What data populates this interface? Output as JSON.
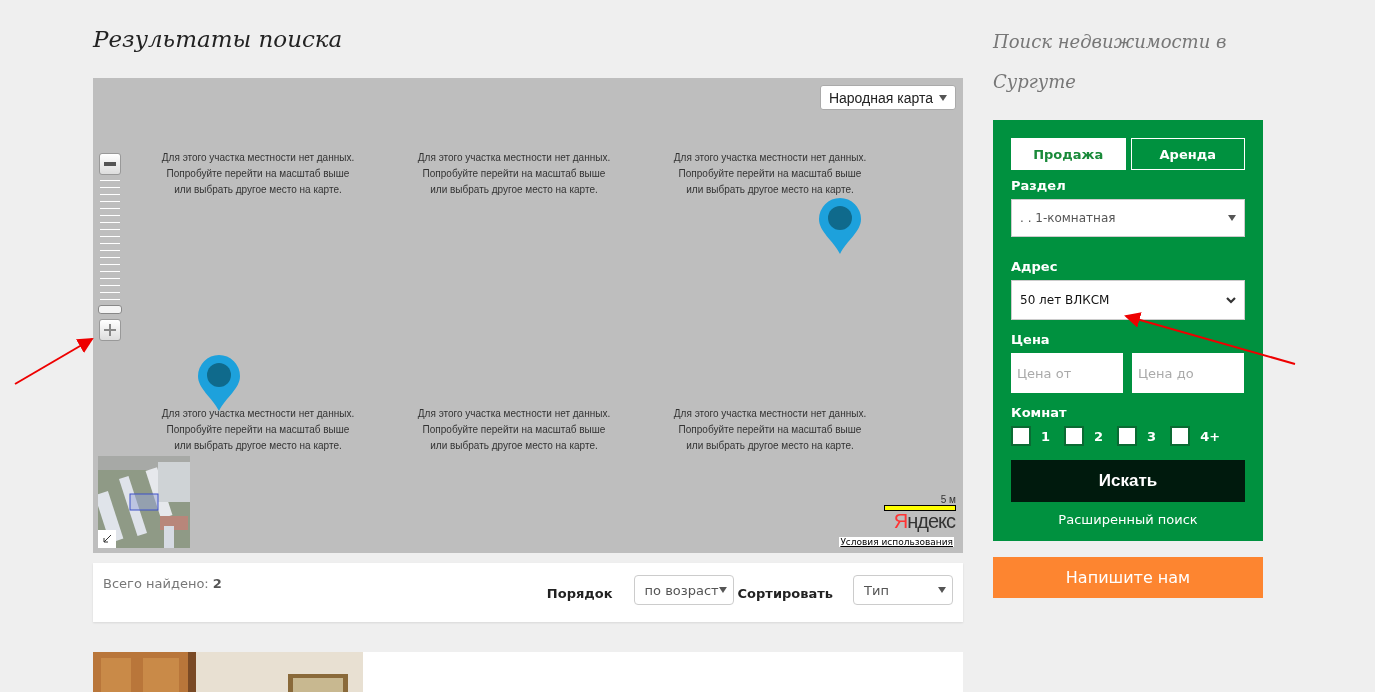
{
  "page_title": "Результаты поиска",
  "map": {
    "type_selector": "Народная карта",
    "tiles": [
      {
        "lines": [
          "Для этого участка местности нет данных.",
          "Попробуйте перейти на масштаб выше",
          "или выбрать другое место на карте."
        ]
      },
      {
        "lines": [
          "Для этого участка местности нет данных.",
          "Попробуйте перейти на масштаб выше",
          "или выбрать другое место на карте."
        ]
      },
      {
        "lines": [
          "Для этого участка местности нет данных.",
          "Попробуйте перейти на масштаб выше",
          "или выбрать другое место на карте."
        ]
      },
      {
        "lines": [
          "Для этого участка местности нет данных.",
          "Попробуйте перейти на масштаб выше",
          "или выбрать другое место на карте."
        ]
      },
      {
        "lines": [
          "Для этого участка местности нет данных.",
          "Попробуйте перейти на масштаб выше",
          "или выбрать другое место на карте."
        ]
      },
      {
        "lines": [
          "Для этого участка местности нет данных.",
          "Попробуйте перейти на масштаб выше",
          "или выбрать другое место на карте."
        ]
      }
    ],
    "scale": "5 м",
    "logo": "Яндекс",
    "terms_link": "Условия использования"
  },
  "results_bar": {
    "total": "Всего найдено: **2**",
    "order_label": "Порядок",
    "order_value": "по возраст",
    "sort_label": "Сортировать",
    "sort_value": "Тип"
  },
  "sidebar": {
    "title": "Поиск недвижимости в Сургуте",
    "tabs": [
      {
        "label": "Продажа",
        "selected": true
      },
      {
        "label": "Аренда",
        "selected": false
      }
    ],
    "section_label": "Раздел",
    "section_value": ". . 1-комнатная",
    "address_label": "Адрес",
    "address_value": "50 лет ВЛКСМ",
    "price_label": "Цена",
    "price_from": {
      "placeholder": "Цена от"
    },
    "price_to": {
      "placeholder": "Цена до"
    },
    "rooms_label": "Комнат",
    "rooms": [
      {
        "label": "1",
        "checked": false
      },
      {
        "label": "2",
        "checked": false
      },
      {
        "label": "3",
        "checked": false
      },
      {
        "label": "4+",
        "checked": false
      }
    ],
    "search_button": "Искать",
    "advanced_link": "Расширенный поиск",
    "contact_button": "Напишите нам"
  }
}
